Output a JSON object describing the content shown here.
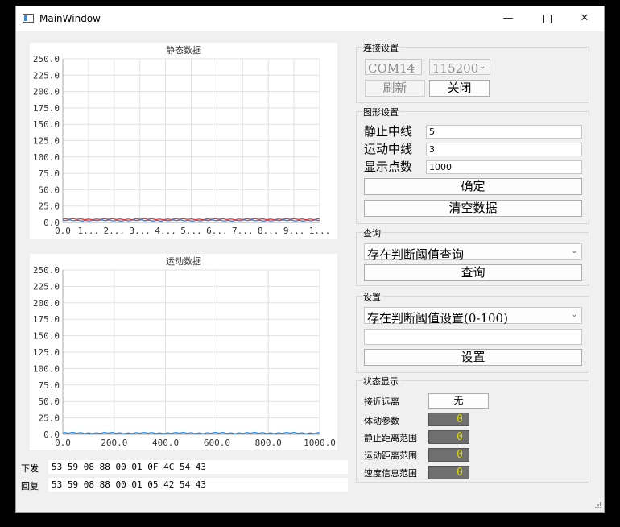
{
  "window": {
    "title": "MainWindow"
  },
  "charts": {
    "static_title": "静态数据",
    "motion_title": "运动数据",
    "static_y_ticks": [
      "250.0",
      "225.0",
      "200.0",
      "175.0",
      "150.0",
      "125.0",
      "100.0",
      "75.0",
      "50.0",
      "25.0",
      "0.0"
    ],
    "static_x_ticks": [
      "0.0",
      "1...",
      "2...",
      "3...",
      "4...",
      "5...",
      "6...",
      "7...",
      "8...",
      "9...",
      "1..."
    ],
    "motion_y_ticks": [
      "250.0",
      "225.0",
      "200.0",
      "175.0",
      "150.0",
      "125.0",
      "100.0",
      "75.0",
      "50.0",
      "25.0",
      "0.0"
    ],
    "motion_x_ticks": [
      "0.0",
      "200.0",
      "400.0",
      "600.0",
      "800.0",
      "1000.0"
    ]
  },
  "chart_data": [
    {
      "type": "line",
      "title": "静态数据",
      "ylim": [
        0,
        250
      ],
      "xlim": [
        0,
        1000
      ],
      "grid": true,
      "series": [
        {
          "color": "#e53935",
          "values_approx": [
            5,
            5
          ]
        },
        {
          "color": "#1e88e5",
          "values_approx": [
            3,
            3
          ]
        }
      ]
    },
    {
      "type": "line",
      "title": "运动数据",
      "ylim": [
        0,
        250
      ],
      "xlim": [
        0,
        1000
      ],
      "grid": true,
      "series": [
        {
          "color": "#1e88e5",
          "values_approx": [
            2,
            2
          ]
        }
      ]
    }
  ],
  "log": {
    "send_label": "下发",
    "send_value": "53 59 08 88 00 01 0F 4C 54 43",
    "reply_label": "回复",
    "reply_value": "53 59 08 88 00 01 05 42 54 43"
  },
  "connection": {
    "group_title": "连接设置",
    "port": "COM14",
    "baud": "115200",
    "refresh_label": "刷新",
    "close_label": "关闭"
  },
  "graph": {
    "group_title": "图形设置",
    "static_mid_label": "静止中线",
    "static_mid_value": "5",
    "motion_mid_label": "运动中线",
    "motion_mid_value": "3",
    "points_label": "显示点数",
    "points_value": "1000",
    "ok_label": "确定",
    "clear_label": "清空数据"
  },
  "query": {
    "group_title": "查询",
    "option": "存在判断阈值查询",
    "button_label": "查询"
  },
  "settings": {
    "group_title": "设置",
    "option": "存在判断阈值设置(0-100)",
    "input_value": "",
    "button_label": "设置"
  },
  "status": {
    "group_title": "状态显示",
    "approach_label": "接近远离",
    "approach_value": "无",
    "body_label": "体动参数",
    "body_value": "0",
    "static_range_label": "静止距离范围",
    "static_range_value": "0",
    "motion_range_label": "运动距离范围",
    "motion_range_value": "0",
    "speed_label": "速度信息范围",
    "speed_value": "0"
  }
}
